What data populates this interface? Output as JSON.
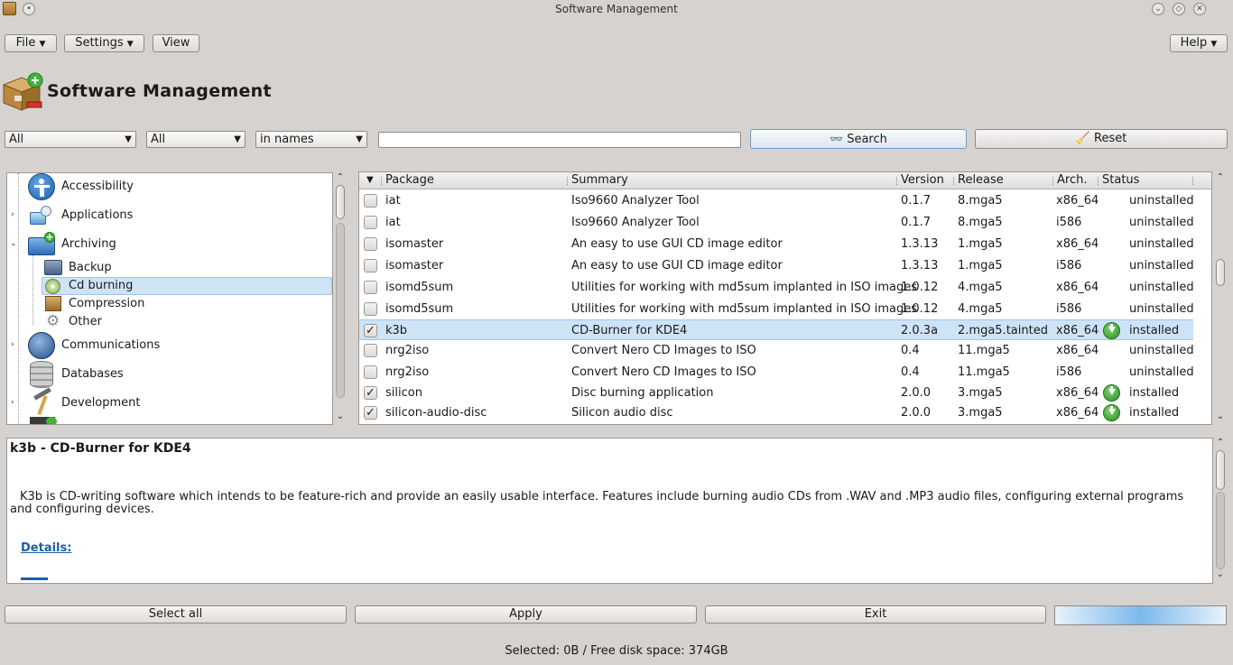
{
  "window": {
    "title": "Software Management"
  },
  "menu": {
    "file": "File",
    "settings": "Settings",
    "view": "View",
    "help": "Help"
  },
  "header": {
    "title": "Software Management"
  },
  "filters": {
    "filter1": "All",
    "filter2": "All",
    "search_mode": "in names",
    "search_value": "",
    "search_button": "Search",
    "reset_button": "Reset"
  },
  "categories": [
    {
      "label": "Accessibility",
      "icon": "accessibility-icon",
      "expandable": false
    },
    {
      "label": "Applications",
      "icon": "applications-icon",
      "expandable": true
    },
    {
      "label": "Archiving",
      "icon": "archiving-icon",
      "expanded": true
    },
    {
      "label": "Backup",
      "icon": "backup-icon",
      "child": true
    },
    {
      "label": "Cd burning",
      "icon": "cd-burning-icon",
      "child": true,
      "selected": true
    },
    {
      "label": "Compression",
      "icon": "compression-icon",
      "child": true
    },
    {
      "label": "Other",
      "icon": "other-gear-icon",
      "child": true
    },
    {
      "label": "Communications",
      "icon": "communications-icon",
      "expandable": true
    },
    {
      "label": "Databases",
      "icon": "databases-icon",
      "expandable": false
    },
    {
      "label": "Development",
      "icon": "development-icon",
      "expandable": true
    }
  ],
  "table": {
    "columns": [
      "Package",
      "Summary",
      "Version",
      "Release",
      "Arch.",
      "Status"
    ],
    "rows": [
      {
        "checked": false,
        "package": "iat",
        "summary": "Iso9660 Analyzer Tool",
        "version": "0.1.7",
        "release": "8.mga5",
        "arch": "x86_64",
        "status": "uninstalled"
      },
      {
        "checked": false,
        "package": "iat",
        "summary": "Iso9660 Analyzer Tool",
        "version": "0.1.7",
        "release": "8.mga5",
        "arch": "i586",
        "status": "uninstalled"
      },
      {
        "checked": false,
        "package": "isomaster",
        "summary": "An easy to use GUI CD image editor",
        "version": "1.3.13",
        "release": "1.mga5",
        "arch": "x86_64",
        "status": "uninstalled"
      },
      {
        "checked": false,
        "package": "isomaster",
        "summary": "An easy to use GUI CD image editor",
        "version": "1.3.13",
        "release": "1.mga5",
        "arch": "i586",
        "status": "uninstalled"
      },
      {
        "checked": false,
        "package": "isomd5sum",
        "summary": "Utilities for working with md5sum implanted in ISO images",
        "version": "1.0.12",
        "release": "4.mga5",
        "arch": "x86_64",
        "status": "uninstalled"
      },
      {
        "checked": false,
        "package": "isomd5sum",
        "summary": "Utilities for working with md5sum implanted in ISO images",
        "version": "1.0.12",
        "release": "4.mga5",
        "arch": "i586",
        "status": "uninstalled"
      },
      {
        "checked": true,
        "package": "k3b",
        "summary": "CD-Burner for KDE4",
        "version": "2.0.3a",
        "release": "2.mga5.tainted",
        "arch": "x86_64",
        "status": "installed",
        "selected": true
      },
      {
        "checked": false,
        "package": "nrg2iso",
        "summary": "Convert Nero CD Images to ISO",
        "version": "0.4",
        "release": "11.mga5",
        "arch": "x86_64",
        "status": "uninstalled"
      },
      {
        "checked": false,
        "package": "nrg2iso",
        "summary": "Convert Nero CD Images to ISO",
        "version": "0.4",
        "release": "11.mga5",
        "arch": "i586",
        "status": "uninstalled"
      },
      {
        "checked": true,
        "package": "silicon",
        "summary": "Disc burning application",
        "version": "2.0.0",
        "release": "3.mga5",
        "arch": "x86_64",
        "status": "installed"
      },
      {
        "checked": true,
        "package": "silicon-audio-disc",
        "summary": "Silicon audio disc",
        "version": "2.0.0",
        "release": "3.mga5",
        "arch": "x86_64",
        "status": "installed"
      }
    ]
  },
  "description": {
    "title": "k3b - CD-Burner for KDE4",
    "text": "K3b is CD-writing software which intends to be feature-rich and provide an easily usable interface. Features include burning audio CDs from .WAV and .MP3 audio files, configuring external programs and configuring devices.",
    "details_link": "Details:"
  },
  "bottom": {
    "select_all": "Select all",
    "apply": "Apply",
    "exit": "Exit"
  },
  "status": "Selected: 0B / Free disk space: 374GB",
  "colors": {
    "selection": "#cfe3f7",
    "link": "#1b5fa8",
    "installed_icon": "#2e8f2a"
  }
}
